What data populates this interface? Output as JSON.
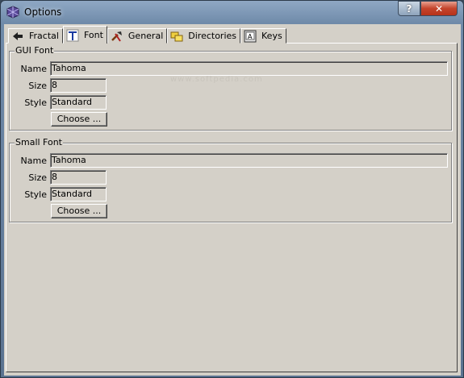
{
  "window": {
    "title": "Options",
    "help_label": "?",
    "close_label": "✕"
  },
  "watermark": "www.softpedia.com",
  "tabs": [
    {
      "label": "Fractal",
      "icon": "fractal-icon"
    },
    {
      "label": "Font",
      "icon": "font-icon",
      "active": true
    },
    {
      "label": "General",
      "icon": "tools-icon"
    },
    {
      "label": "Directories",
      "icon": "folders-icon"
    },
    {
      "label": "Keys",
      "icon": "keys-icon"
    }
  ],
  "gui_font": {
    "title": "GUI Font",
    "name_label": "Name",
    "name_value": "Tahoma",
    "size_label": "Size",
    "size_value": "8",
    "style_label": "Style",
    "style_value": "Standard",
    "choose_label": "Choose ..."
  },
  "small_font": {
    "title": "Small Font",
    "name_label": "Name",
    "name_value": "Tahoma",
    "size_label": "Size",
    "size_value": "8",
    "style_label": "Style",
    "style_value": "Standard",
    "choose_label": "Choose ..."
  },
  "colors": {
    "dialog_bg": "#d4d0c8",
    "titlebar": "#7f98b6",
    "close": "#c4442c"
  }
}
